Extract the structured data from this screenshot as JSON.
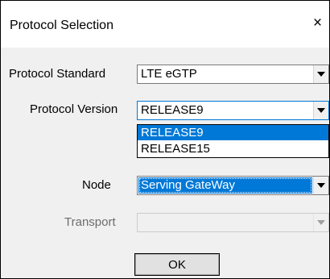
{
  "dialog": {
    "title": "Protocol Selection",
    "close_glyph": "×"
  },
  "fields": {
    "protocol_standard": {
      "label": "Protocol Standard",
      "value": "LTE eGTP"
    },
    "protocol_version": {
      "label": "Protocol Version",
      "value": "RELEASE9",
      "options": [
        "RELEASE9",
        "RELEASE15"
      ],
      "highlighted_option": "RELEASE9"
    },
    "node": {
      "label": "Node",
      "value": "Serving GateWay"
    },
    "transport": {
      "label": "Transport",
      "value": "",
      "disabled": true
    }
  },
  "buttons": {
    "ok_label": "OK"
  },
  "icons": {
    "dropdown": "chevron-down-icon",
    "close": "close-icon"
  },
  "colors": {
    "selection": "#0078d7",
    "dialog_bg": "#f0f0f0"
  }
}
